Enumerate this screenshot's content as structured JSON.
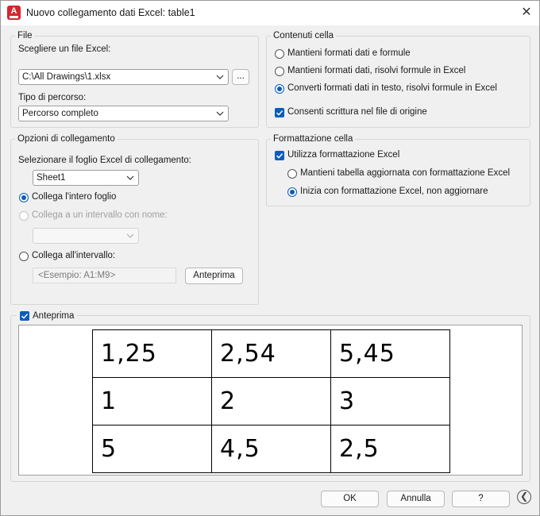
{
  "window": {
    "title": "Nuovo collegamento dati Excel: table1",
    "app_icon_letter": "A",
    "close_glyph": "✕"
  },
  "file_group": {
    "legend": "File",
    "choose_label": "Scegliere un file Excel:",
    "file_value": "C:\\All Drawings\\1.xlsx",
    "browse_label": "...",
    "path_type_label": "Tipo di percorso:",
    "path_type_value": "Percorso completo"
  },
  "link_options": {
    "legend": "Opzioni di collegamento",
    "sheet_label": "Selezionare il foglio Excel di collegamento:",
    "sheet_value": "Sheet1",
    "link_whole_sheet": "Collega l'intero foglio",
    "link_named_range": "Collega a un intervallo con nome:",
    "named_range_value": "",
    "link_range": "Collega all'intervallo:",
    "range_placeholder": "<Esempio: A1:M9>",
    "preview_button": "Anteprima"
  },
  "cell_contents": {
    "legend": "Contenuti cella",
    "opt1": "Mantieni formati dati e formule",
    "opt2": "Mantieni formati dati, risolvi formule in Excel",
    "opt3": "Converti formati dati in testo, risolvi formule in Excel",
    "selected": "opt3",
    "allow_write": "Consenti scrittura nel file di origine",
    "allow_write_checked": true
  },
  "cell_formatting": {
    "legend": "Formattazione cella",
    "use_excel_format": "Utilizza formattazione Excel",
    "use_excel_format_checked": true,
    "opt_keep_updated": "Mantieni tabella aggiornata con formattazione Excel",
    "opt_start_excel": "Inizia con formattazione Excel, non aggiornare",
    "selected": "opt_start_excel"
  },
  "preview": {
    "label": "Anteprima",
    "checked": true,
    "rows": [
      [
        "1,25",
        "2,54",
        "5,45"
      ],
      [
        "1",
        "2",
        "3"
      ],
      [
        "5",
        "4,5",
        "2,5"
      ]
    ]
  },
  "footer": {
    "ok": "OK",
    "cancel": "Annulla",
    "help": "?",
    "back_glyph": "❮"
  },
  "colors": {
    "accent": "#0a5dbd",
    "app_icon": "#d4262d",
    "dialog_bg": "#f0f0f0"
  }
}
